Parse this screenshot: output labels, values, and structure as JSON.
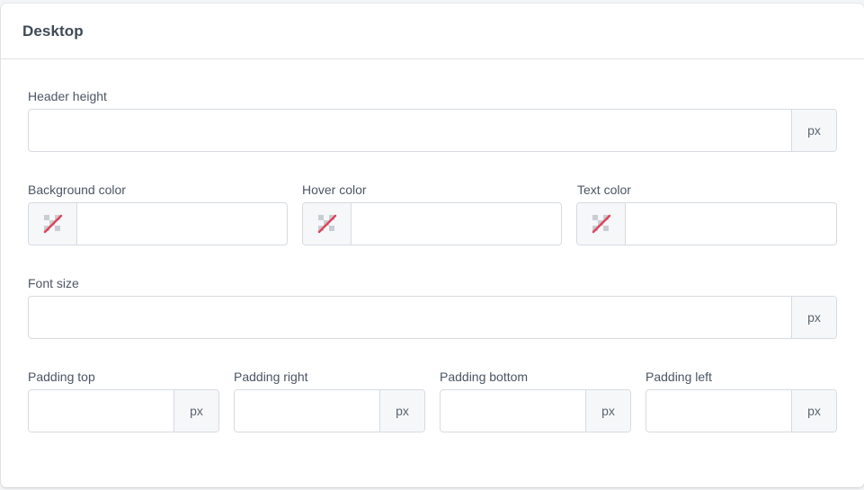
{
  "card": {
    "title": "Desktop"
  },
  "fields": {
    "header_height": {
      "label": "Header height",
      "value": "",
      "unit": "px"
    },
    "background_color": {
      "label": "Background color",
      "value": ""
    },
    "hover_color": {
      "label": "Hover color",
      "value": ""
    },
    "text_color": {
      "label": "Text color",
      "value": ""
    },
    "font_size": {
      "label": "Font size",
      "value": "",
      "unit": "px"
    },
    "padding_top": {
      "label": "Padding top",
      "value": "",
      "unit": "px"
    },
    "padding_right": {
      "label": "Padding right",
      "value": "",
      "unit": "px"
    },
    "padding_bottom": {
      "label": "Padding bottom",
      "value": "",
      "unit": "px"
    },
    "padding_left": {
      "label": "Padding left",
      "value": "",
      "unit": "px"
    }
  },
  "icons": {
    "swatch": "no-color-swatch-icon"
  },
  "colors": {
    "no_color_slash": "#e0415a",
    "checker": "#c9cdd3"
  }
}
